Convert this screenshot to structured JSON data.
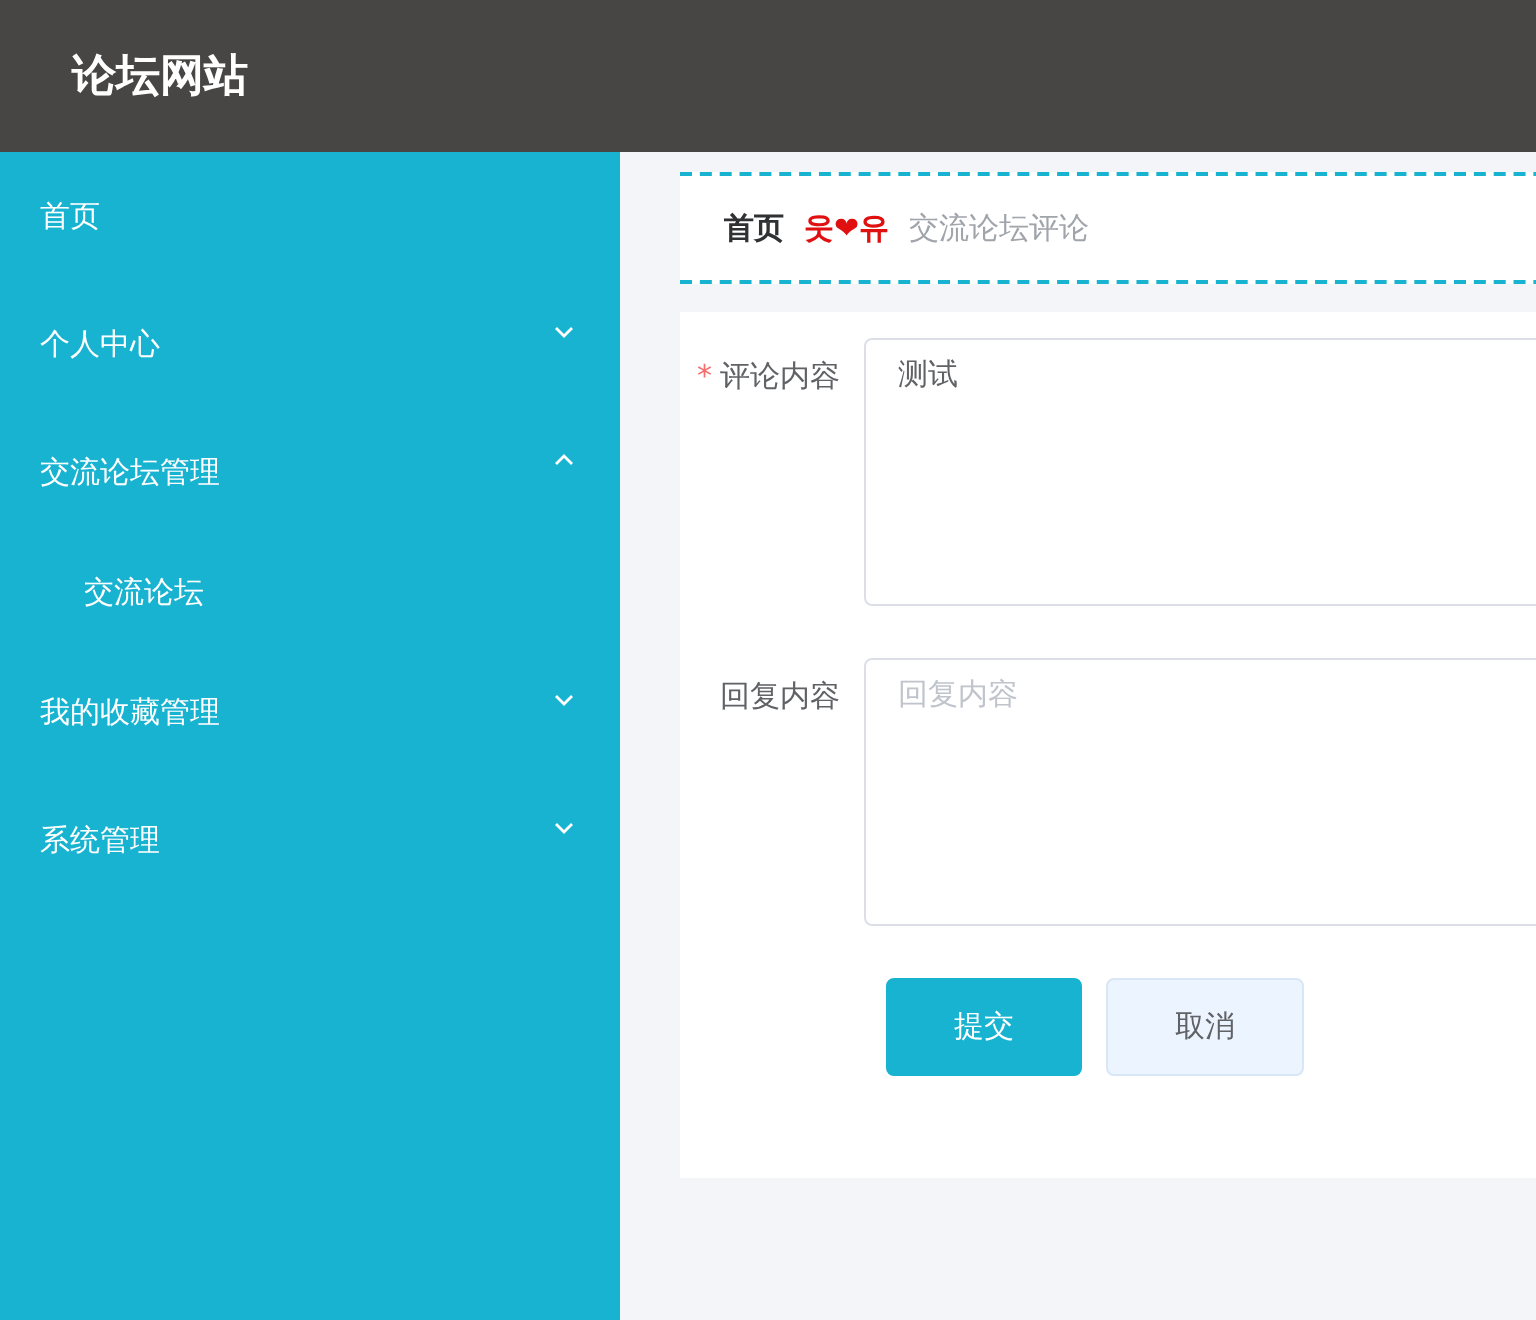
{
  "header": {
    "title": "论坛网站"
  },
  "sidebar": {
    "items": [
      {
        "kind": "link",
        "label": "首页"
      },
      {
        "kind": "group",
        "label": "个人中心",
        "expanded": false
      },
      {
        "kind": "group",
        "label": "交流论坛管理",
        "expanded": true,
        "children": [
          {
            "label": "交流论坛"
          }
        ]
      },
      {
        "kind": "group",
        "label": "我的收藏管理",
        "expanded": false
      },
      {
        "kind": "group",
        "label": "系统管理",
        "expanded": false
      }
    ]
  },
  "breadcrumb": {
    "items": [
      "首页",
      "交流论坛评论"
    ],
    "separator": "웃❤유"
  },
  "form": {
    "fields": [
      {
        "label": "评论内容",
        "required_mark": "*",
        "value": "测试"
      },
      {
        "label": "回复内容",
        "placeholder": "回复内容"
      }
    ],
    "buttons": [
      {
        "kind": "primary",
        "label": "提交"
      },
      {
        "kind": "secondary",
        "label": "取消"
      }
    ]
  }
}
